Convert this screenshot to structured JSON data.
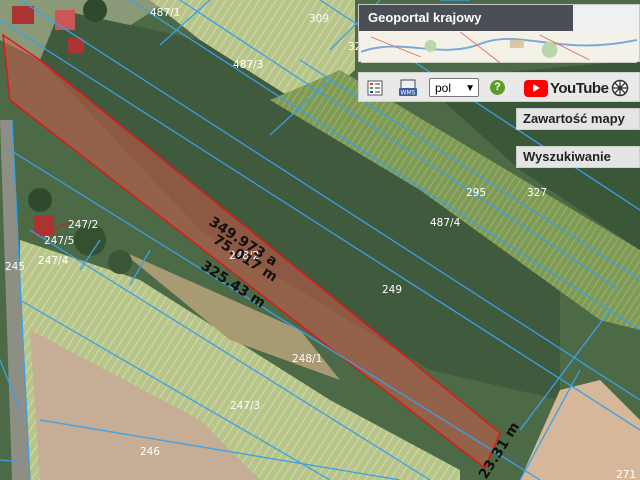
{
  "map": {
    "labels": {
      "p487_1": "487/1",
      "p309": "309",
      "p487_3": "487/3",
      "p32": "32",
      "p295": "295",
      "p327": "327",
      "p487_4": "487/4",
      "p249": "249",
      "p248_2": "248/2",
      "p248_1": "248/1",
      "p247_2": "247/2",
      "p247_5": "247/5",
      "p247_4": "247/4",
      "p245": "245",
      "p247_3": "247/3",
      "p246": "246",
      "p271": "271"
    },
    "measurements": {
      "area": "349.973 a",
      "length": "75.017 m",
      "bottom": "325.43 m",
      "right": "23.31 m"
    }
  },
  "geoportal": {
    "title": "Geoportal krajowy"
  },
  "toolbar": {
    "language": "pol",
    "help": "?",
    "youtube": "YouTube"
  },
  "panels": {
    "content": "Zawartość mapy",
    "search": "Wyszukiwanie"
  }
}
